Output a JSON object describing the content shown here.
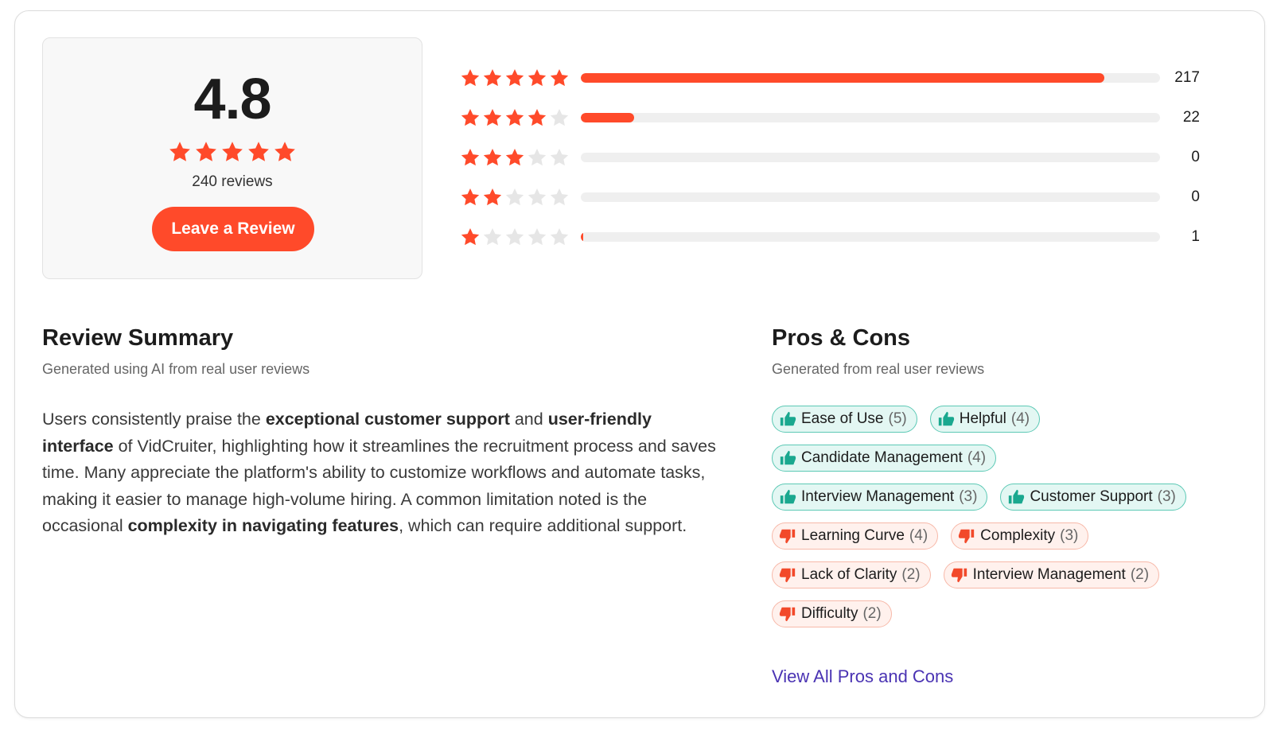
{
  "overall": {
    "rating": "4.8",
    "stars_filled": 5,
    "reviews_label": "240 reviews",
    "cta_label": "Leave a Review"
  },
  "distribution": [
    {
      "stars": 5,
      "count": "217",
      "fraction": 0.904
    },
    {
      "stars": 4,
      "count": "22",
      "fraction": 0.092
    },
    {
      "stars": 3,
      "count": "0",
      "fraction": 0
    },
    {
      "stars": 2,
      "count": "0",
      "fraction": 0
    },
    {
      "stars": 1,
      "count": "1",
      "fraction": 0.004
    }
  ],
  "summary": {
    "title": "Review Summary",
    "subtitle": "Generated using AI from real user reviews",
    "text_parts": [
      {
        "t": "Users consistently praise the ",
        "b": false
      },
      {
        "t": "exceptional customer support",
        "b": true
      },
      {
        "t": " and ",
        "b": false
      },
      {
        "t": "user-friendly interface",
        "b": true
      },
      {
        "t": " of VidCruiter, highlighting how it streamlines the recruitment process and saves time. Many appreciate the platform's ability to customize workflows and automate tasks, making it easier to manage high-volume hiring. A common limitation noted is the occasional ",
        "b": false
      },
      {
        "t": "complexity in navigating features",
        "b": true
      },
      {
        "t": ", which can require additional support.",
        "b": false
      }
    ]
  },
  "pros_cons": {
    "title": "Pros & Cons",
    "subtitle": "Generated from real user reviews",
    "rows": [
      [
        {
          "type": "pro",
          "label": "Ease of Use",
          "count": "(5)"
        },
        {
          "type": "pro",
          "label": "Helpful",
          "count": "(4)"
        }
      ],
      [
        {
          "type": "pro",
          "label": "Candidate Management",
          "count": "(4)"
        }
      ],
      [
        {
          "type": "pro",
          "label": "Interview Management",
          "count": "(3)"
        },
        {
          "type": "pro",
          "label": "Customer Support",
          "count": "(3)"
        }
      ],
      [
        {
          "type": "con",
          "label": "Learning Curve",
          "count": "(4)"
        },
        {
          "type": "con",
          "label": "Complexity",
          "count": "(3)"
        }
      ],
      [
        {
          "type": "con",
          "label": "Lack of Clarity",
          "count": "(2)"
        },
        {
          "type": "con",
          "label": "Interview Management",
          "count": "(2)"
        }
      ],
      [
        {
          "type": "con",
          "label": "Difficulty",
          "count": "(2)"
        }
      ]
    ],
    "view_all_label": "View All Pros and Cons"
  },
  "colors": {
    "accent": "#ff4a2a",
    "star_empty": "#e6e6e6",
    "pro_icon": "#1aa88f",
    "con_icon": "#f2492a",
    "link": "#4a33b3"
  },
  "icons": {
    "star": "star-icon",
    "pro": "thumbs-up-icon",
    "con": "thumbs-down-icon"
  }
}
